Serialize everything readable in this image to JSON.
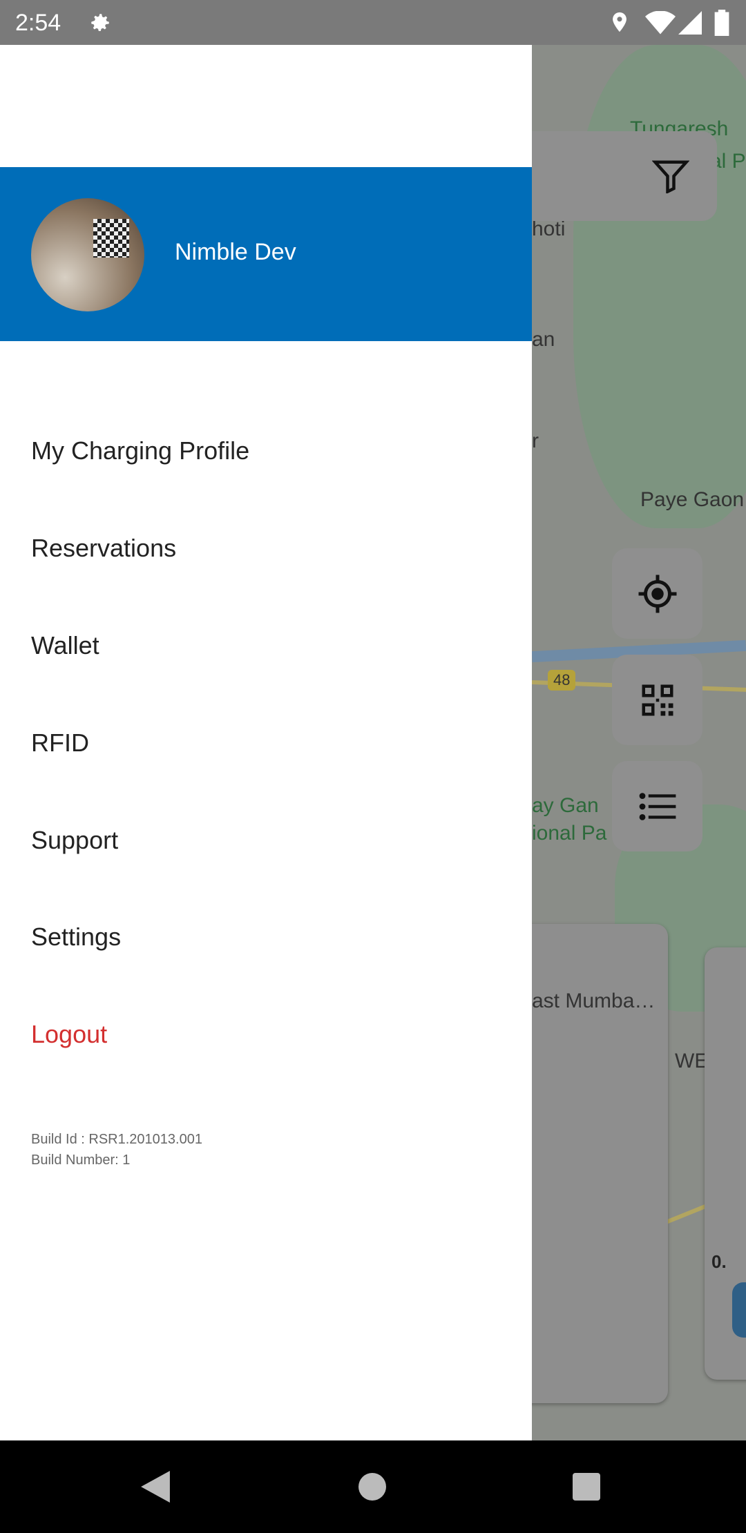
{
  "status_bar": {
    "time": "2:54",
    "icons": [
      "settings-icon",
      "location-icon",
      "wifi-icon",
      "signal-icon",
      "battery-icon"
    ]
  },
  "drawer": {
    "user_name": "Nimble Dev",
    "menu": [
      {
        "label": "My Charging Profile"
      },
      {
        "label": "Reservations"
      },
      {
        "label": "Wallet"
      },
      {
        "label": "RFID"
      },
      {
        "label": "Support"
      },
      {
        "label": "Settings"
      },
      {
        "label": "Logout",
        "color": "#d32f2f"
      }
    ],
    "build_id": "Build Id : RSR1.201013.001",
    "build_number": "Build Number: 1"
  },
  "map": {
    "labels": [
      "Tungaresh",
      "al P",
      "hoti",
      "an",
      "r",
      "Paye Gaon",
      "48",
      "ay Gan",
      "ional Pa",
      "WEST",
      "0."
    ],
    "card_text": "ast Mumba…"
  },
  "colors": {
    "header": "#006db8",
    "logout": "#d32f2f"
  }
}
